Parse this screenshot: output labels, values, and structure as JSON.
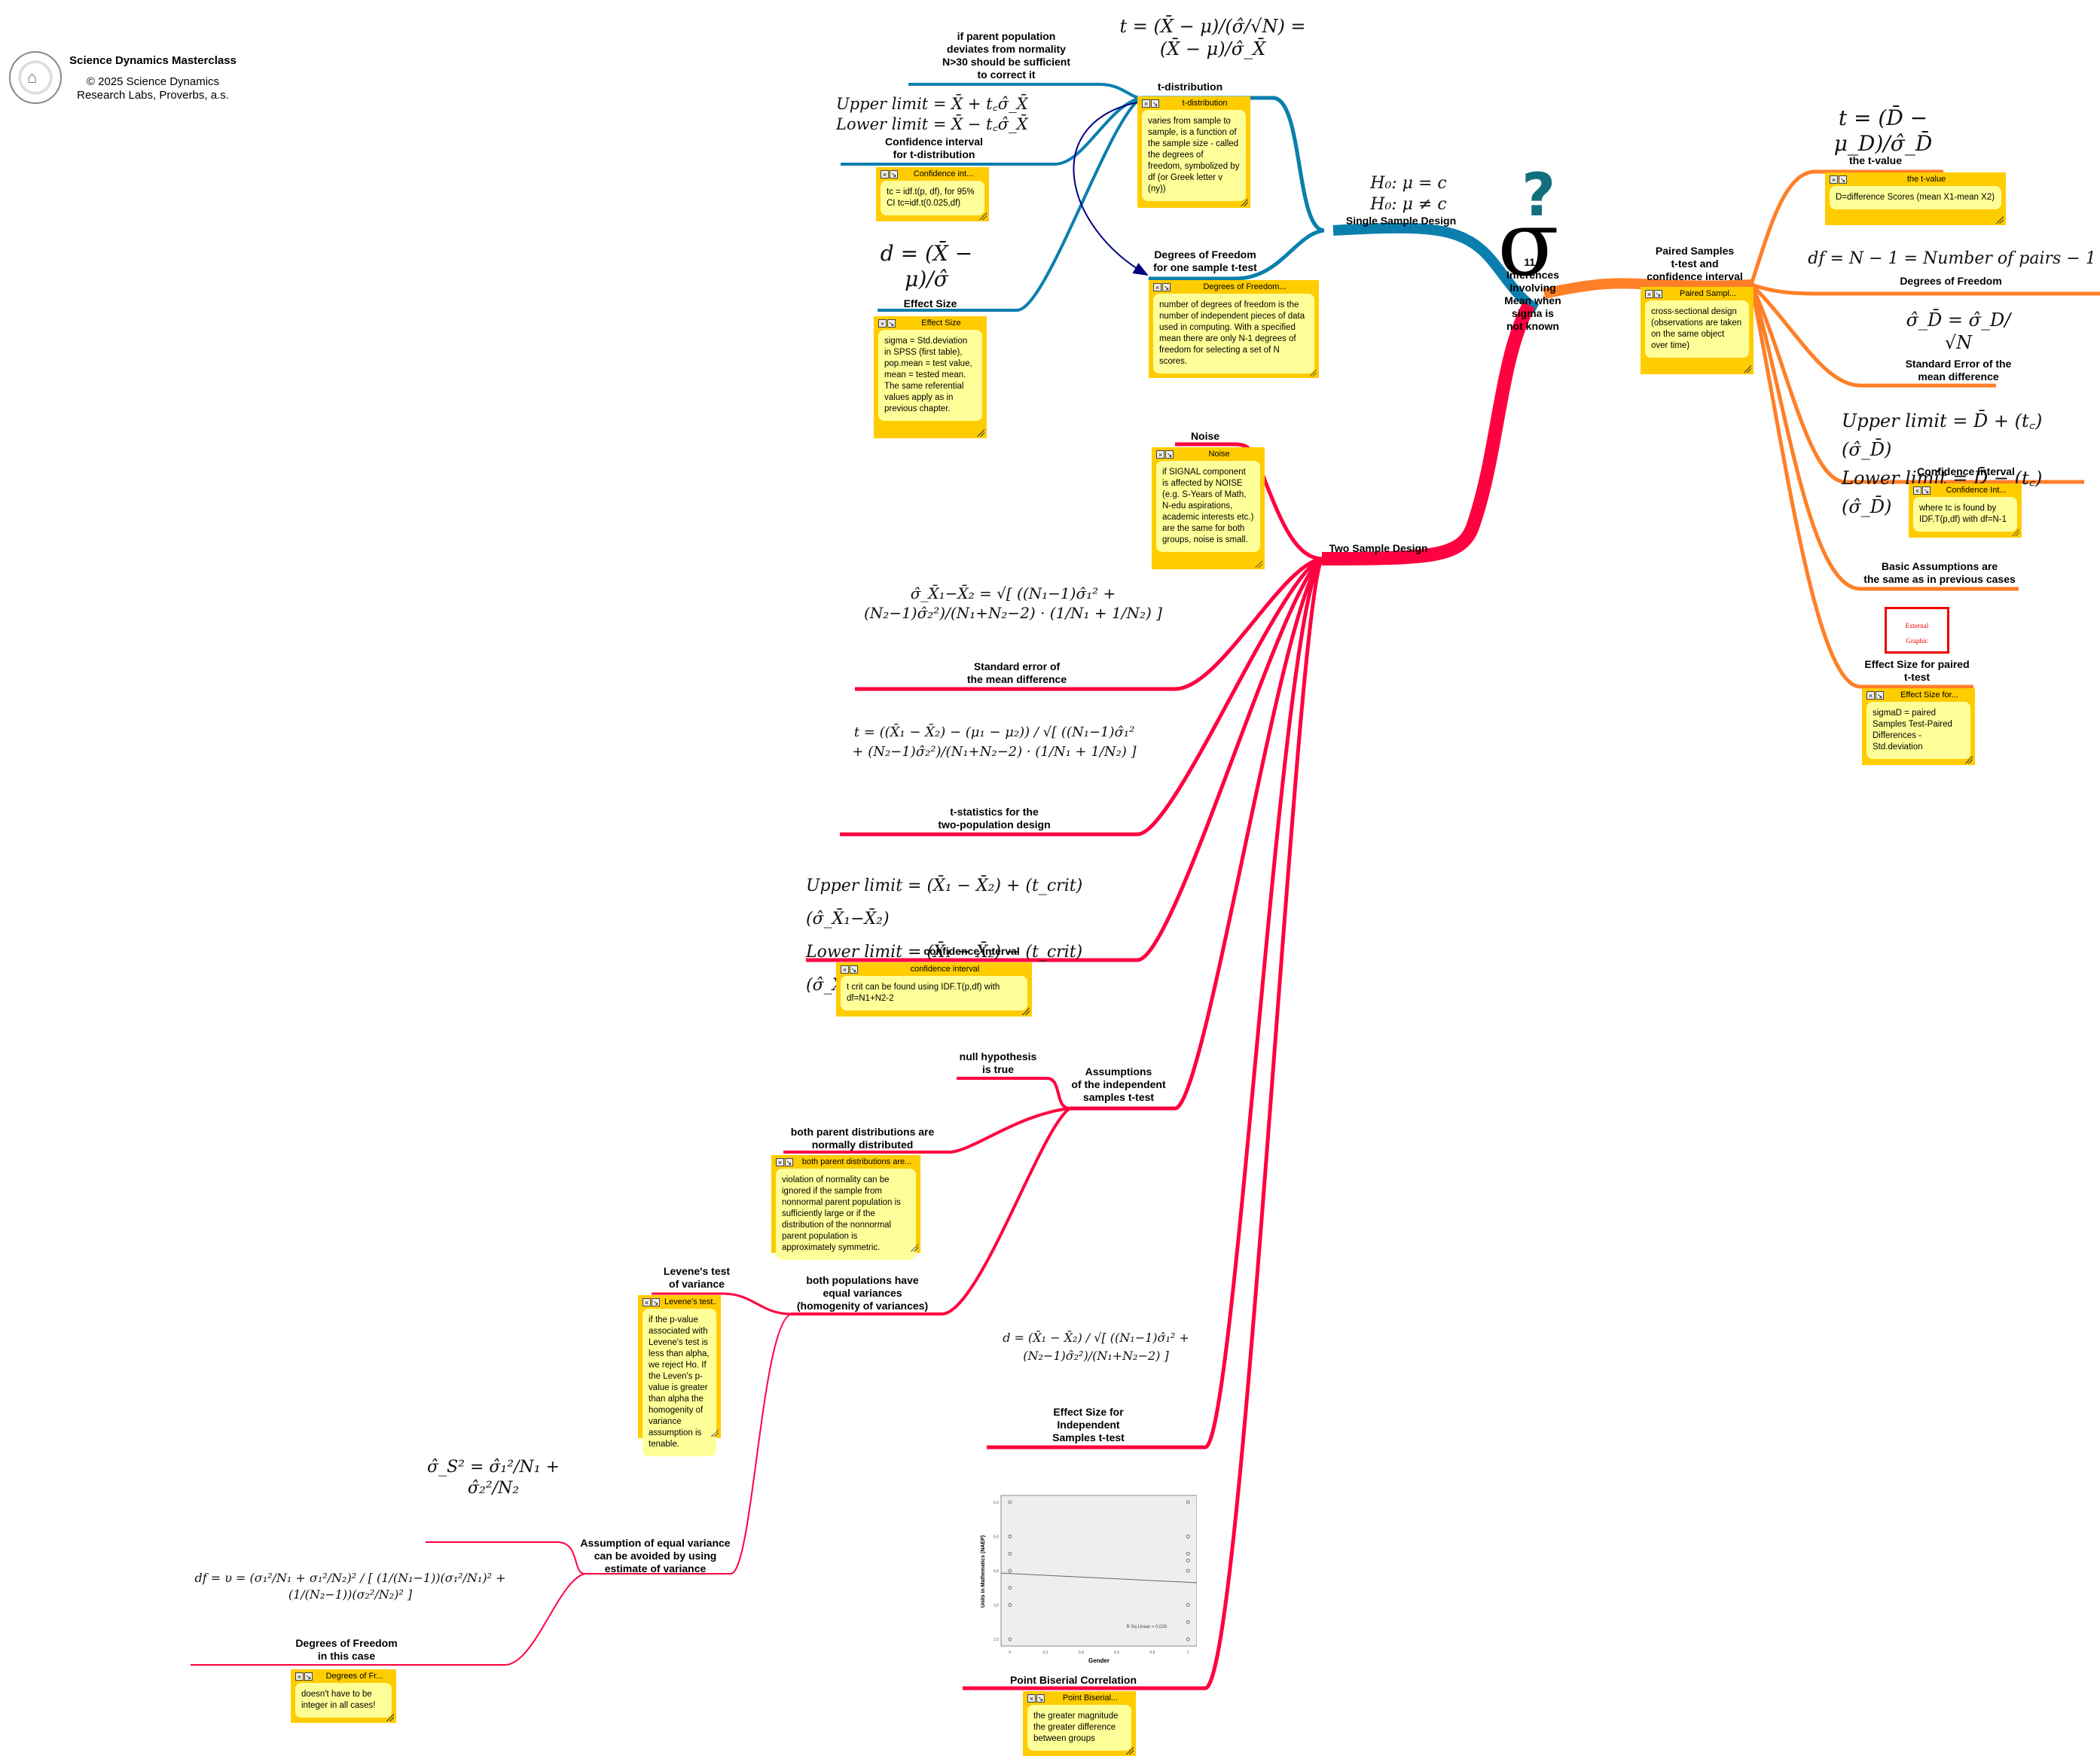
{
  "header": {
    "title": "Science Dynamics Masterclass",
    "copyright": "© 2025 Science Dynamics\nResearch Labs, Proverbs, a.s.",
    "logo_icon": "seal-logo-icon"
  },
  "colors": {
    "single_sample_branch": "#0a7fad",
    "two_sample_branch": "#ff0040",
    "paired_branch": "#ff7f27",
    "note_frame": "#ffcc00",
    "note_body": "#ffff99",
    "arrow": "#000080",
    "question_mark": "#136f7e"
  },
  "central": {
    "label": "11 -\nInferences\nInvolving\nMean when\nsigma is\nnot known",
    "icon_question": "?",
    "icon_sigma": "σ"
  },
  "single_sample": {
    "label": "Single Sample Design",
    "formula": "H₀: μ = c\nH₀: μ ≠ c",
    "t_distribution": {
      "label": "t-distribution",
      "formula": "t = (X̄ − μ)/(σ̂/√N) = (X̄ − μ)/σ̂_X̄",
      "note_title": "t-distribution",
      "note_text": "varies from sample to sample, is a function of the sample size - called the degrees of freedom, symbolized by df (or Greek letter v (ny))"
    },
    "parent_population": {
      "label": "if parent population\ndeviates from normality\nN>30 should be sufficient\nto correct it"
    },
    "confidence_interval": {
      "label": "Confidence interval\nfor t-distribution",
      "formula": "Upper limit = X̄ + t꜀σ̂_X̄\nLower limit = X̄ − t꜀σ̂_X̄",
      "note_title": "Confidence int...",
      "note_text": "tc = idf.t(p, df), for 95%\nCI tc=idf.t(0.025,df)"
    },
    "effect_size": {
      "label": "Effect Size",
      "formula": "d = (X̄ − μ)/σ̂",
      "note_title": "Effect Size",
      "note_text": "sigma = Std.deviation in SPSS (first table), pop.mean = test value, mean = tested mean. The same referential values apply as in previous chapter."
    },
    "degrees_of_freedom": {
      "label": "Degrees of Freedom\nfor one sample t-test",
      "note_title": "Degrees of Freedom...",
      "note_text": "number of degrees of freedom is the number of independent pieces of data used in computing. With a specified mean there are only N-1 degrees of freedom for selecting a set of N scores."
    }
  },
  "paired": {
    "label": "Paired Samples\nt-test and\nconfidence interval",
    "note_title": "Paired Sampl...",
    "note_text": "cross-sectional design (observations are taken on the same object over time)",
    "t_value": {
      "label": "the t-value",
      "formula": "t = (D̄ − μ_D)/σ̂_D̄",
      "note_title": "the t-value",
      "note_text": "D=difference Scores (mean X1-mean X2)"
    },
    "degrees_of_freedom": {
      "label": "Degrees of Freedom",
      "formula": "df = N − 1 = Number of pairs − 1"
    },
    "standard_error": {
      "label": "Standard Error of the\nmean difference",
      "formula": "σ̂_D̄ = σ̂_D/√N"
    },
    "confidence_interval": {
      "label": "Confidence Interval",
      "formula": "Upper limit = D̄ + (t꜀)(σ̂_D̄)\nLower limit = D̄ − (t꜀)(σ̂_D̄)",
      "note_title": "Confidence Int...",
      "note_text": "where tc is found by IDF.T(p,df) with df=N-1"
    },
    "assumptions": {
      "label": "Basic Assumptions are\nthe same as in previous cases"
    },
    "effect_size": {
      "label": "Effect Size for paired\nt-test",
      "external_graphic": "External\nGraphic",
      "note_title": "Effect Size for...",
      "note_text": "sigmaD = paired Samples Test-Paired Differences - Std.deviation"
    }
  },
  "two_sample": {
    "label": "Two Sample Design",
    "noise": {
      "label": "Noise",
      "note_title": "Noise",
      "note_text": "if SIGNAL component is affected by NOISE (e.g. S-Years of Math, N-edu aspirations, academic interests etc.) are the same for both groups, noise is small."
    },
    "standard_error": {
      "label": "Standard error of\nthe mean difference",
      "formula": "σ̂_X̄₁−X̄₂ = √[ ((N₁−1)σ̂₁² + (N₂−1)σ̂₂²)/(N₁+N₂−2) · (1/N₁ + 1/N₂) ]"
    },
    "t_statistic": {
      "label": "t-statistics for the\ntwo-population design",
      "formula": "t = ((X̄₁ − X̄₂) − (μ₁ − μ₂)) / √[ ((N₁−1)σ̂₁² + (N₂−1)σ̂₂²)/(N₁+N₂−2) · (1/N₁ + 1/N₂) ]"
    },
    "confidence_interval": {
      "label": "confidence interval",
      "formula": "Upper limit = (X̄₁ − X̄₂) + (t_crit)(σ̂_X̄₁−X̄₂)\nLower limit = (X̄₁ − X̄₂) − (t_crit)(σ̂_X̄₁−X̄₂)",
      "note_title": "confidence interval",
      "note_text": "t crit can be found using IDF.T(p,df) with df=N1+N2-2"
    },
    "assumptions": {
      "label": "Assumptions\nof the independent\nsamples t-test",
      "null_hypothesis": "null hypothesis\nis true",
      "normality": {
        "label": "both parent distributions are\nnormally distributed",
        "note_title": "both parent distributions are...",
        "note_text": "violation of normality can be ignored if the sample from nonnormal parent population is sufficiently large or if the distribution of the nonnormal parent population is approximately symmetric."
      },
      "equal_variances": {
        "label": "both populations have\nequal variances\n(homogenity of variances)",
        "levene": {
          "label": "Levene's test\nof variance",
          "note_title": "Levene's test...",
          "note_text": "if the p-value associated with Levene's test is less than alpha, we reject Ho. If the Leven's p-value is greater than alpha the homogenity of variance assumption is tenable."
        },
        "avoid": {
          "label": "Assumption of equal variance\ncan be avoided by using\nestimate of variance",
          "formula": "σ̂_S² = σ̂₁²/N₁ + σ̂₂²/N₂",
          "df_label": "Degrees of Freedom\nin this case",
          "df_formula": "df = υ = (σ₁²/N₁ + σ₁²/N₂)² / [ (1/(N₁−1))(σ₁²/N₁)² + (1/(N₂−1))(σ₂²/N₂)² ]",
          "note_title": "Degrees of Fr...",
          "note_text": "doesn't have to be integer in all cases!"
        }
      }
    },
    "effect_size": {
      "label": "Effect Size for\nIndependent\nSamples t-test",
      "formula": "d = (X̄₁ − X̄₂) / √[ ((N₁−1)σ̂₁² + (N₂−1)σ̂₂²)/(N₁+N₂−2) ]"
    },
    "point_biserial": {
      "label": "Point Biserial Correlation",
      "note_title": "Point Biserial...",
      "note_text": "the greater magnitude the greater difference between groups"
    }
  },
  "chart_data": {
    "type": "scatter",
    "title": "",
    "xlabel": "Gender",
    "ylabel": "Units in Mathematics (NAEP)",
    "xlim": [
      -0.05,
      1.05
    ],
    "ylim": [
      1.8,
      6.2
    ],
    "xticks": [
      "0",
      "0,2",
      "0,4",
      "0,6",
      "0,8",
      "1"
    ],
    "xtick_values": [
      0,
      0.2,
      0.4,
      0.6,
      0.8,
      1
    ],
    "yticks": [
      "2,0",
      "3,0",
      "4,0",
      "5,0",
      "6,0"
    ],
    "ytick_values": [
      2,
      3,
      4,
      5,
      6
    ],
    "points": [
      {
        "x": 0,
        "y": 6.0
      },
      {
        "x": 0,
        "y": 5.0
      },
      {
        "x": 0,
        "y": 4.5
      },
      {
        "x": 0,
        "y": 4.0
      },
      {
        "x": 0,
        "y": 3.5
      },
      {
        "x": 0,
        "y": 3.0
      },
      {
        "x": 0,
        "y": 2.0
      },
      {
        "x": 1,
        "y": 6.0
      },
      {
        "x": 1,
        "y": 5.0
      },
      {
        "x": 1,
        "y": 4.5
      },
      {
        "x": 1,
        "y": 4.3
      },
      {
        "x": 1,
        "y": 4.0
      },
      {
        "x": 1,
        "y": 3.0
      },
      {
        "x": 1,
        "y": 2.5
      },
      {
        "x": 1,
        "y": 2.0
      }
    ],
    "fit_line": {
      "x": [
        -0.05,
        1.05
      ],
      "y": [
        3.93,
        3.65
      ]
    },
    "annotation": "R Sq Linear = 0,029",
    "grid": false
  }
}
